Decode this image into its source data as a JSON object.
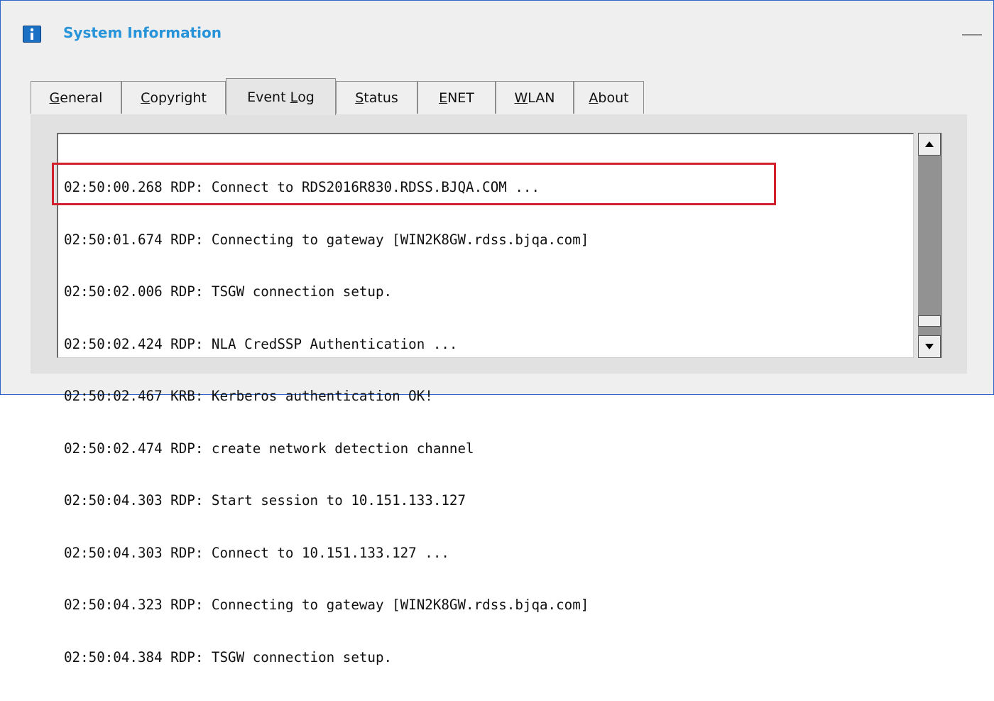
{
  "window": {
    "title": "System Information"
  },
  "tabs": [
    {
      "pre": "",
      "mnemonic": "G",
      "post": "eneral",
      "active": false
    },
    {
      "pre": "",
      "mnemonic": "C",
      "post": "opyright",
      "active": false
    },
    {
      "pre": "Event ",
      "mnemonic": "L",
      "post": "og",
      "active": true
    },
    {
      "pre": "",
      "mnemonic": "S",
      "post": "tatus",
      "active": false
    },
    {
      "pre": "",
      "mnemonic": "E",
      "post": "NET",
      "active": false
    },
    {
      "pre": "",
      "mnemonic": "W",
      "post": "LAN",
      "active": false
    },
    {
      "pre": "",
      "mnemonic": "A",
      "post": "bout",
      "active": false
    }
  ],
  "event_log": {
    "lines": [
      "02:50:00.268 RDP: Connect to RDS2016R830.RDSS.BJQA.COM ...",
      "02:50:01.674 RDP: Connecting to gateway [WIN2K8GW.rdss.bjqa.com]",
      "02:50:02.006 RDP: TSGW connection setup.",
      "02:50:02.424 RDP: NLA CredSSP Authentication ...",
      "02:50:02.467 KRB: Kerberos authentication OK!",
      "02:50:02.474 RDP: create network detection channel",
      "02:50:04.303 RDP: Start session to 10.151.133.127",
      "02:50:04.303 RDP: Connect to 10.151.133.127 ...",
      "02:50:04.323 RDP: Connecting to gateway [WIN2K8GW.rdss.bjqa.com]",
      "02:50:04.384 RDP: TSGW connection setup."
    ]
  },
  "scrollbar": {
    "position_fraction": 0.95
  },
  "colors": {
    "title": "#2793d9",
    "highlight": "#d2202f",
    "window_border": "#2e63c8"
  },
  "icons": {
    "title_icon": "info-icon"
  }
}
